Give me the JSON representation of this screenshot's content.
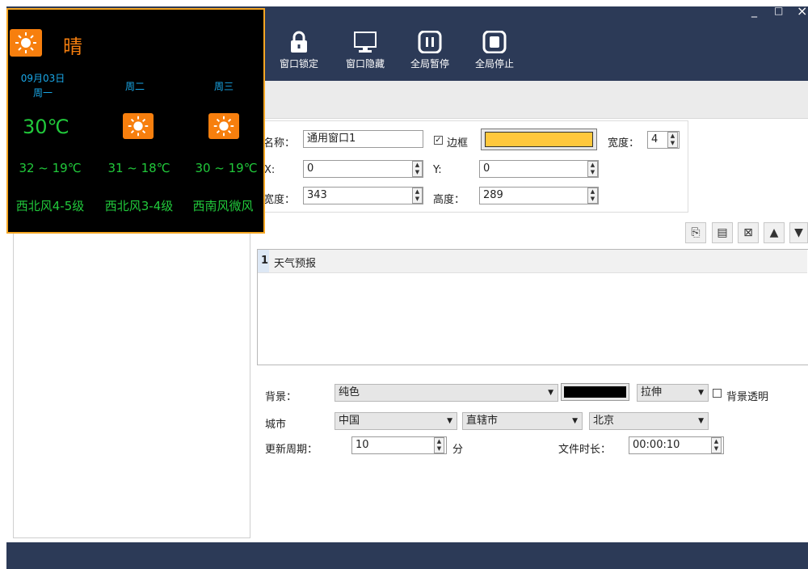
{
  "window_controls": {
    "minimize": "_",
    "maximize": "□",
    "close": "×"
  },
  "toolbar": [
    {
      "label": "窗口锁定",
      "icon": "lock-icon"
    },
    {
      "label": "窗口隐藏",
      "icon": "monitor-icon"
    },
    {
      "label": "全局暂停",
      "icon": "pause-icon"
    },
    {
      "label": "全局停止",
      "icon": "stop-icon"
    }
  ],
  "weather": {
    "condition": "晴",
    "date": "09月03日",
    "days": [
      "周一",
      "周二",
      "周三"
    ],
    "current_temp": "30℃",
    "ranges": [
      "32 ~ 19℃",
      "31 ~ 18℃",
      "30 ~ 19℃"
    ],
    "winds": [
      "西北风4-5级",
      "西北风3-4级",
      "西南风微风"
    ],
    "colors": {
      "border": "#f5a623",
      "icon_bg": "#f77f0e",
      "text": "#21c93b",
      "day_text": "#1aa8e8",
      "condition_text": "#f77f0e"
    }
  },
  "props": {
    "name_label": "名称：",
    "name_value": "通用窗口1",
    "border_label": "边框",
    "border_checked": true,
    "border_color": "#ffc83d",
    "width_label": "宽度：",
    "border_width": "4",
    "x_label": "X:",
    "x_value": "0",
    "y_label": "Y:",
    "y_value": "0",
    "w_label": "宽度：",
    "w_value": "343",
    "h_label": "高度：",
    "h_value": "289"
  },
  "list": {
    "rows": [
      {
        "index": "1",
        "name": "天气预报"
      }
    ]
  },
  "settings": {
    "bg_label": "背景：",
    "bg_mode": "纯色",
    "bg_color": "#000000",
    "stretch": "拉伸",
    "transparent_label": "背景透明",
    "city_label": "城市",
    "country": "中国",
    "province": "直辖市",
    "city": "北京",
    "period_label": "更新周期：",
    "period_value": "10",
    "period_unit": "分",
    "duration_label": "文件时长：",
    "duration_value": "00:00:10"
  }
}
